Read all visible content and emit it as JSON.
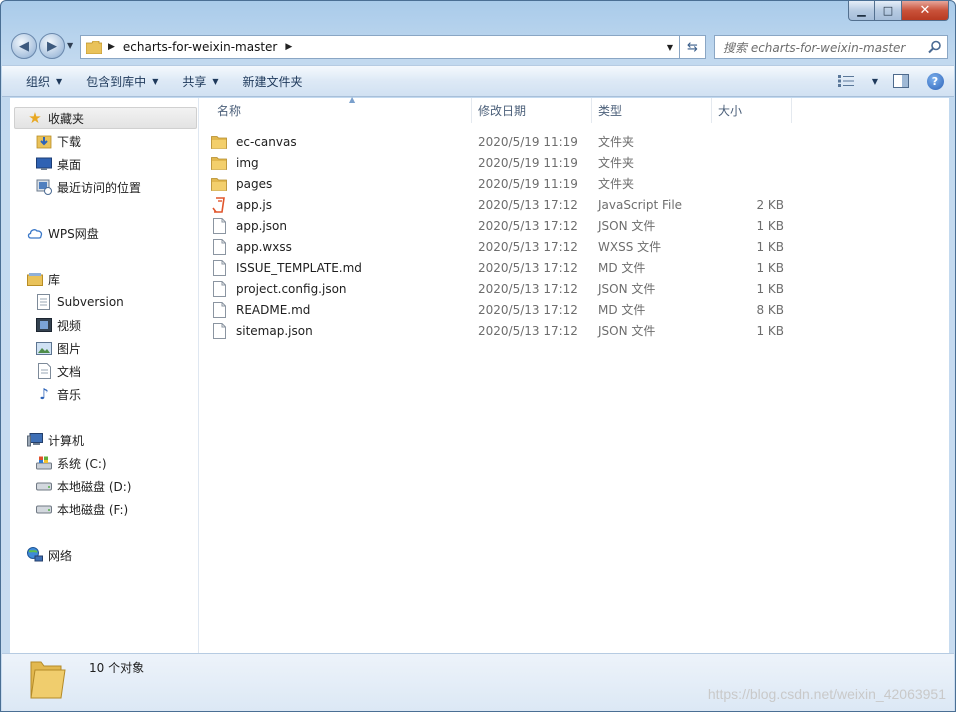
{
  "window": {
    "caption_buttons": {
      "minimize": "▁",
      "maximize": "□",
      "close": "✕"
    }
  },
  "address_bar": {
    "path": "echarts-for-weixin-master",
    "search_placeholder": "搜索 echarts-for-weixin-master"
  },
  "toolbar": {
    "organize": "组织",
    "include_in_library": "包含到库中",
    "share": "共享",
    "new_folder": "新建文件夹"
  },
  "nav_pane": {
    "favorites": {
      "label": "收藏夹",
      "items": [
        "下载",
        "桌面",
        "最近访问的位置"
      ]
    },
    "wps": "WPS网盘",
    "libraries": {
      "label": "库",
      "items": [
        "Subversion",
        "视频",
        "图片",
        "文档",
        "音乐"
      ]
    },
    "computer": {
      "label": "计算机",
      "items": [
        "系统 (C:)",
        "本地磁盘 (D:)",
        "本地磁盘 (F:)"
      ]
    },
    "network": "网络"
  },
  "columns": {
    "name": "名称",
    "date": "修改日期",
    "type": "类型",
    "size": "大小"
  },
  "files": [
    {
      "name": "ec-canvas",
      "date": "2020/5/19 11:19",
      "type": "文件夹",
      "size": "",
      "icon": "folder"
    },
    {
      "name": "img",
      "date": "2020/5/19 11:19",
      "type": "文件夹",
      "size": "",
      "icon": "folder"
    },
    {
      "name": "pages",
      "date": "2020/5/19 11:19",
      "type": "文件夹",
      "size": "",
      "icon": "folder"
    },
    {
      "name": "app.js",
      "date": "2020/5/13 17:12",
      "type": "JavaScript File",
      "size": "2 KB",
      "icon": "js"
    },
    {
      "name": "app.json",
      "date": "2020/5/13 17:12",
      "type": "JSON 文件",
      "size": "1 KB",
      "icon": "doc"
    },
    {
      "name": "app.wxss",
      "date": "2020/5/13 17:12",
      "type": "WXSS 文件",
      "size": "1 KB",
      "icon": "doc"
    },
    {
      "name": "ISSUE_TEMPLATE.md",
      "date": "2020/5/13 17:12",
      "type": "MD 文件",
      "size": "1 KB",
      "icon": "doc"
    },
    {
      "name": "project.config.json",
      "date": "2020/5/13 17:12",
      "type": "JSON 文件",
      "size": "1 KB",
      "icon": "doc"
    },
    {
      "name": "README.md",
      "date": "2020/5/13 17:12",
      "type": "MD 文件",
      "size": "8 KB",
      "icon": "doc"
    },
    {
      "name": "sitemap.json",
      "date": "2020/5/13 17:12",
      "type": "JSON 文件",
      "size": "1 KB",
      "icon": "doc"
    }
  ],
  "status": {
    "count_text": "10 个对象"
  },
  "watermark": "https://blog.csdn.net/weixin_42063951"
}
